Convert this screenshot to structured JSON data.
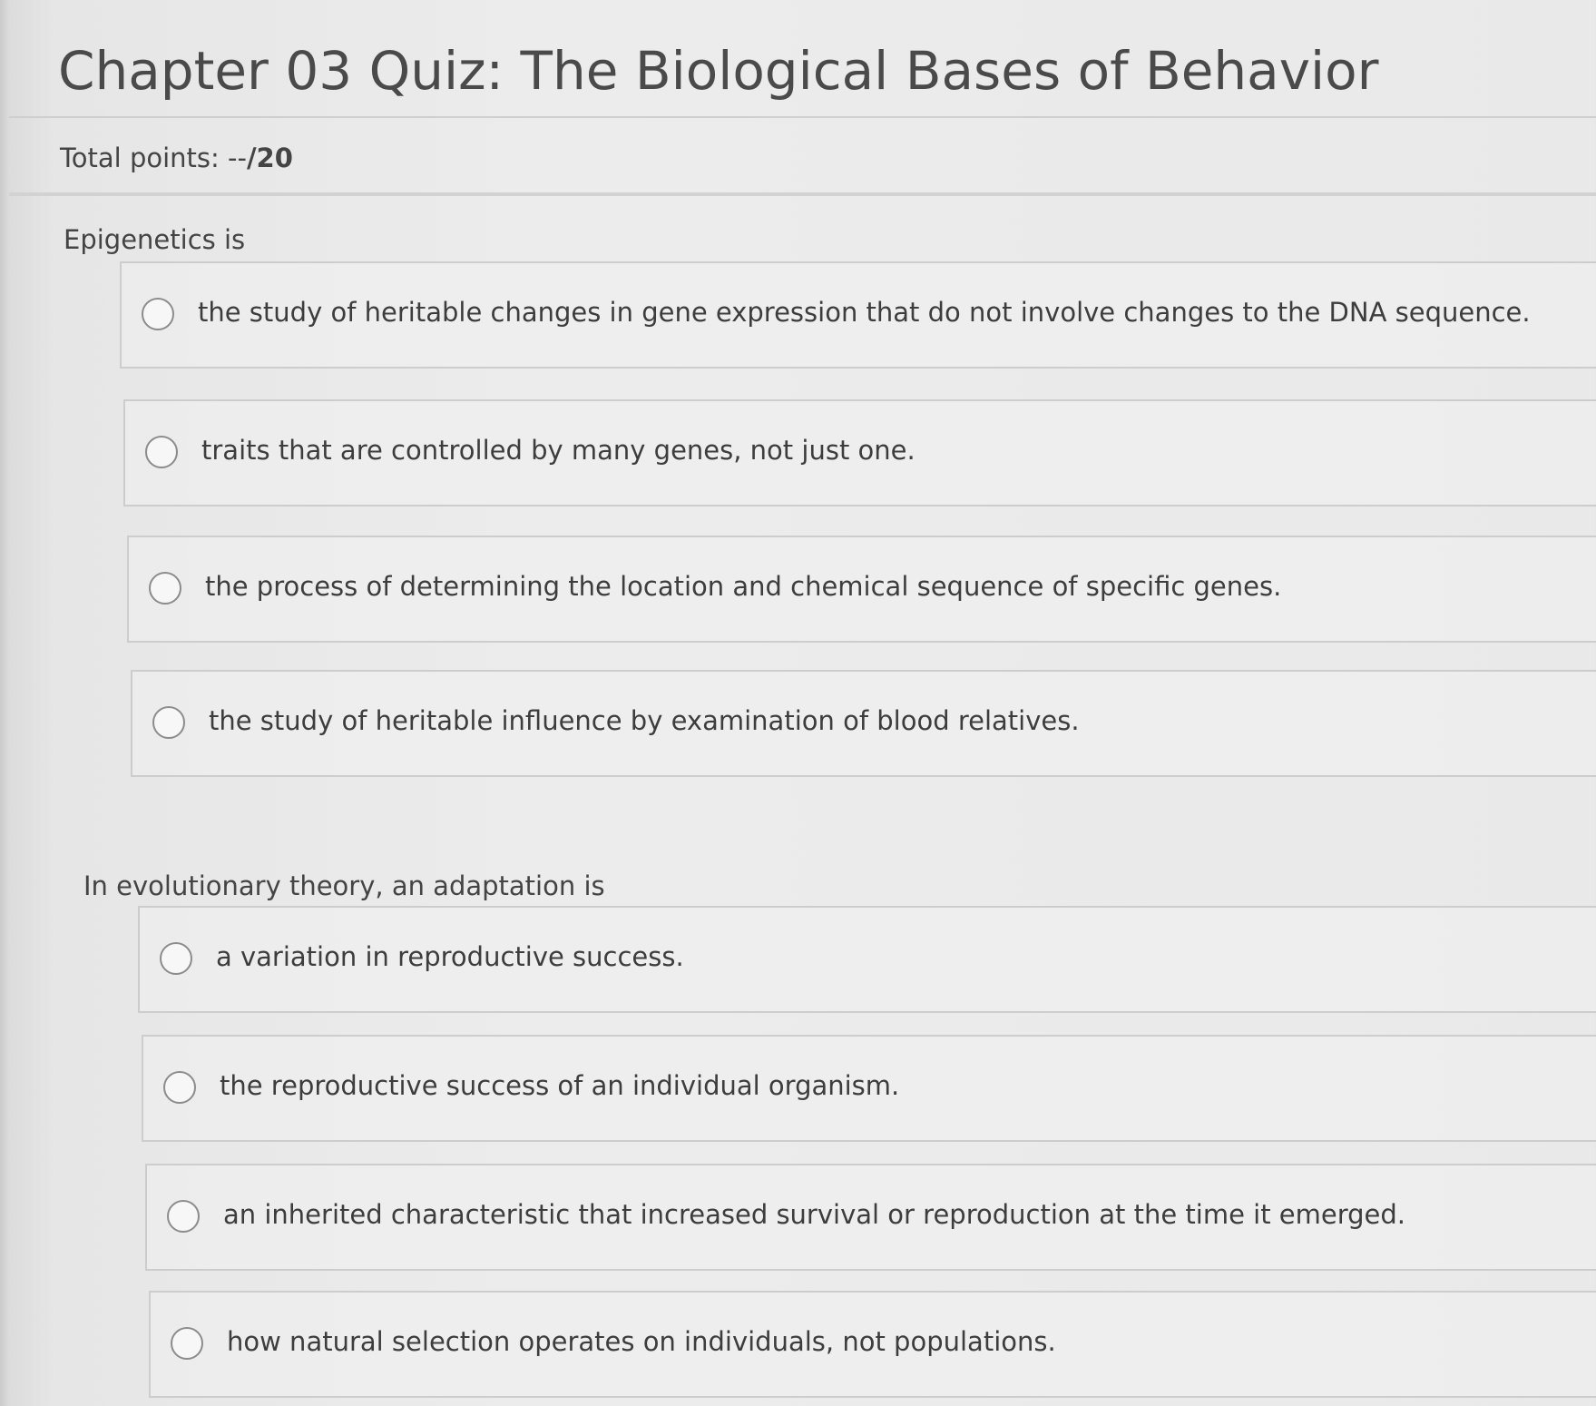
{
  "quiz": {
    "title": "Chapter 03 Quiz: The Biological Bases of Behavior",
    "points_label": "Total points: --",
    "points_value": "/20"
  },
  "questions": [
    {
      "prompt": "Epigenetics is",
      "options": [
        "the study of heritable changes in gene expression that do not involve changes to the DNA sequence.",
        "traits that are controlled by many genes, not just one.",
        "the process of determining the location and chemical sequence of specific genes.",
        "the study of heritable influence by examination of blood relatives."
      ]
    },
    {
      "prompt": "In evolutionary theory, an adaptation is",
      "options": [
        "a variation in reproductive success.",
        "the reproductive success of an individual organism.",
        "an inherited characteristic that increased survival or reproduction at the time it emerged.",
        "how natural selection operates on individuals, not populations."
      ]
    }
  ]
}
